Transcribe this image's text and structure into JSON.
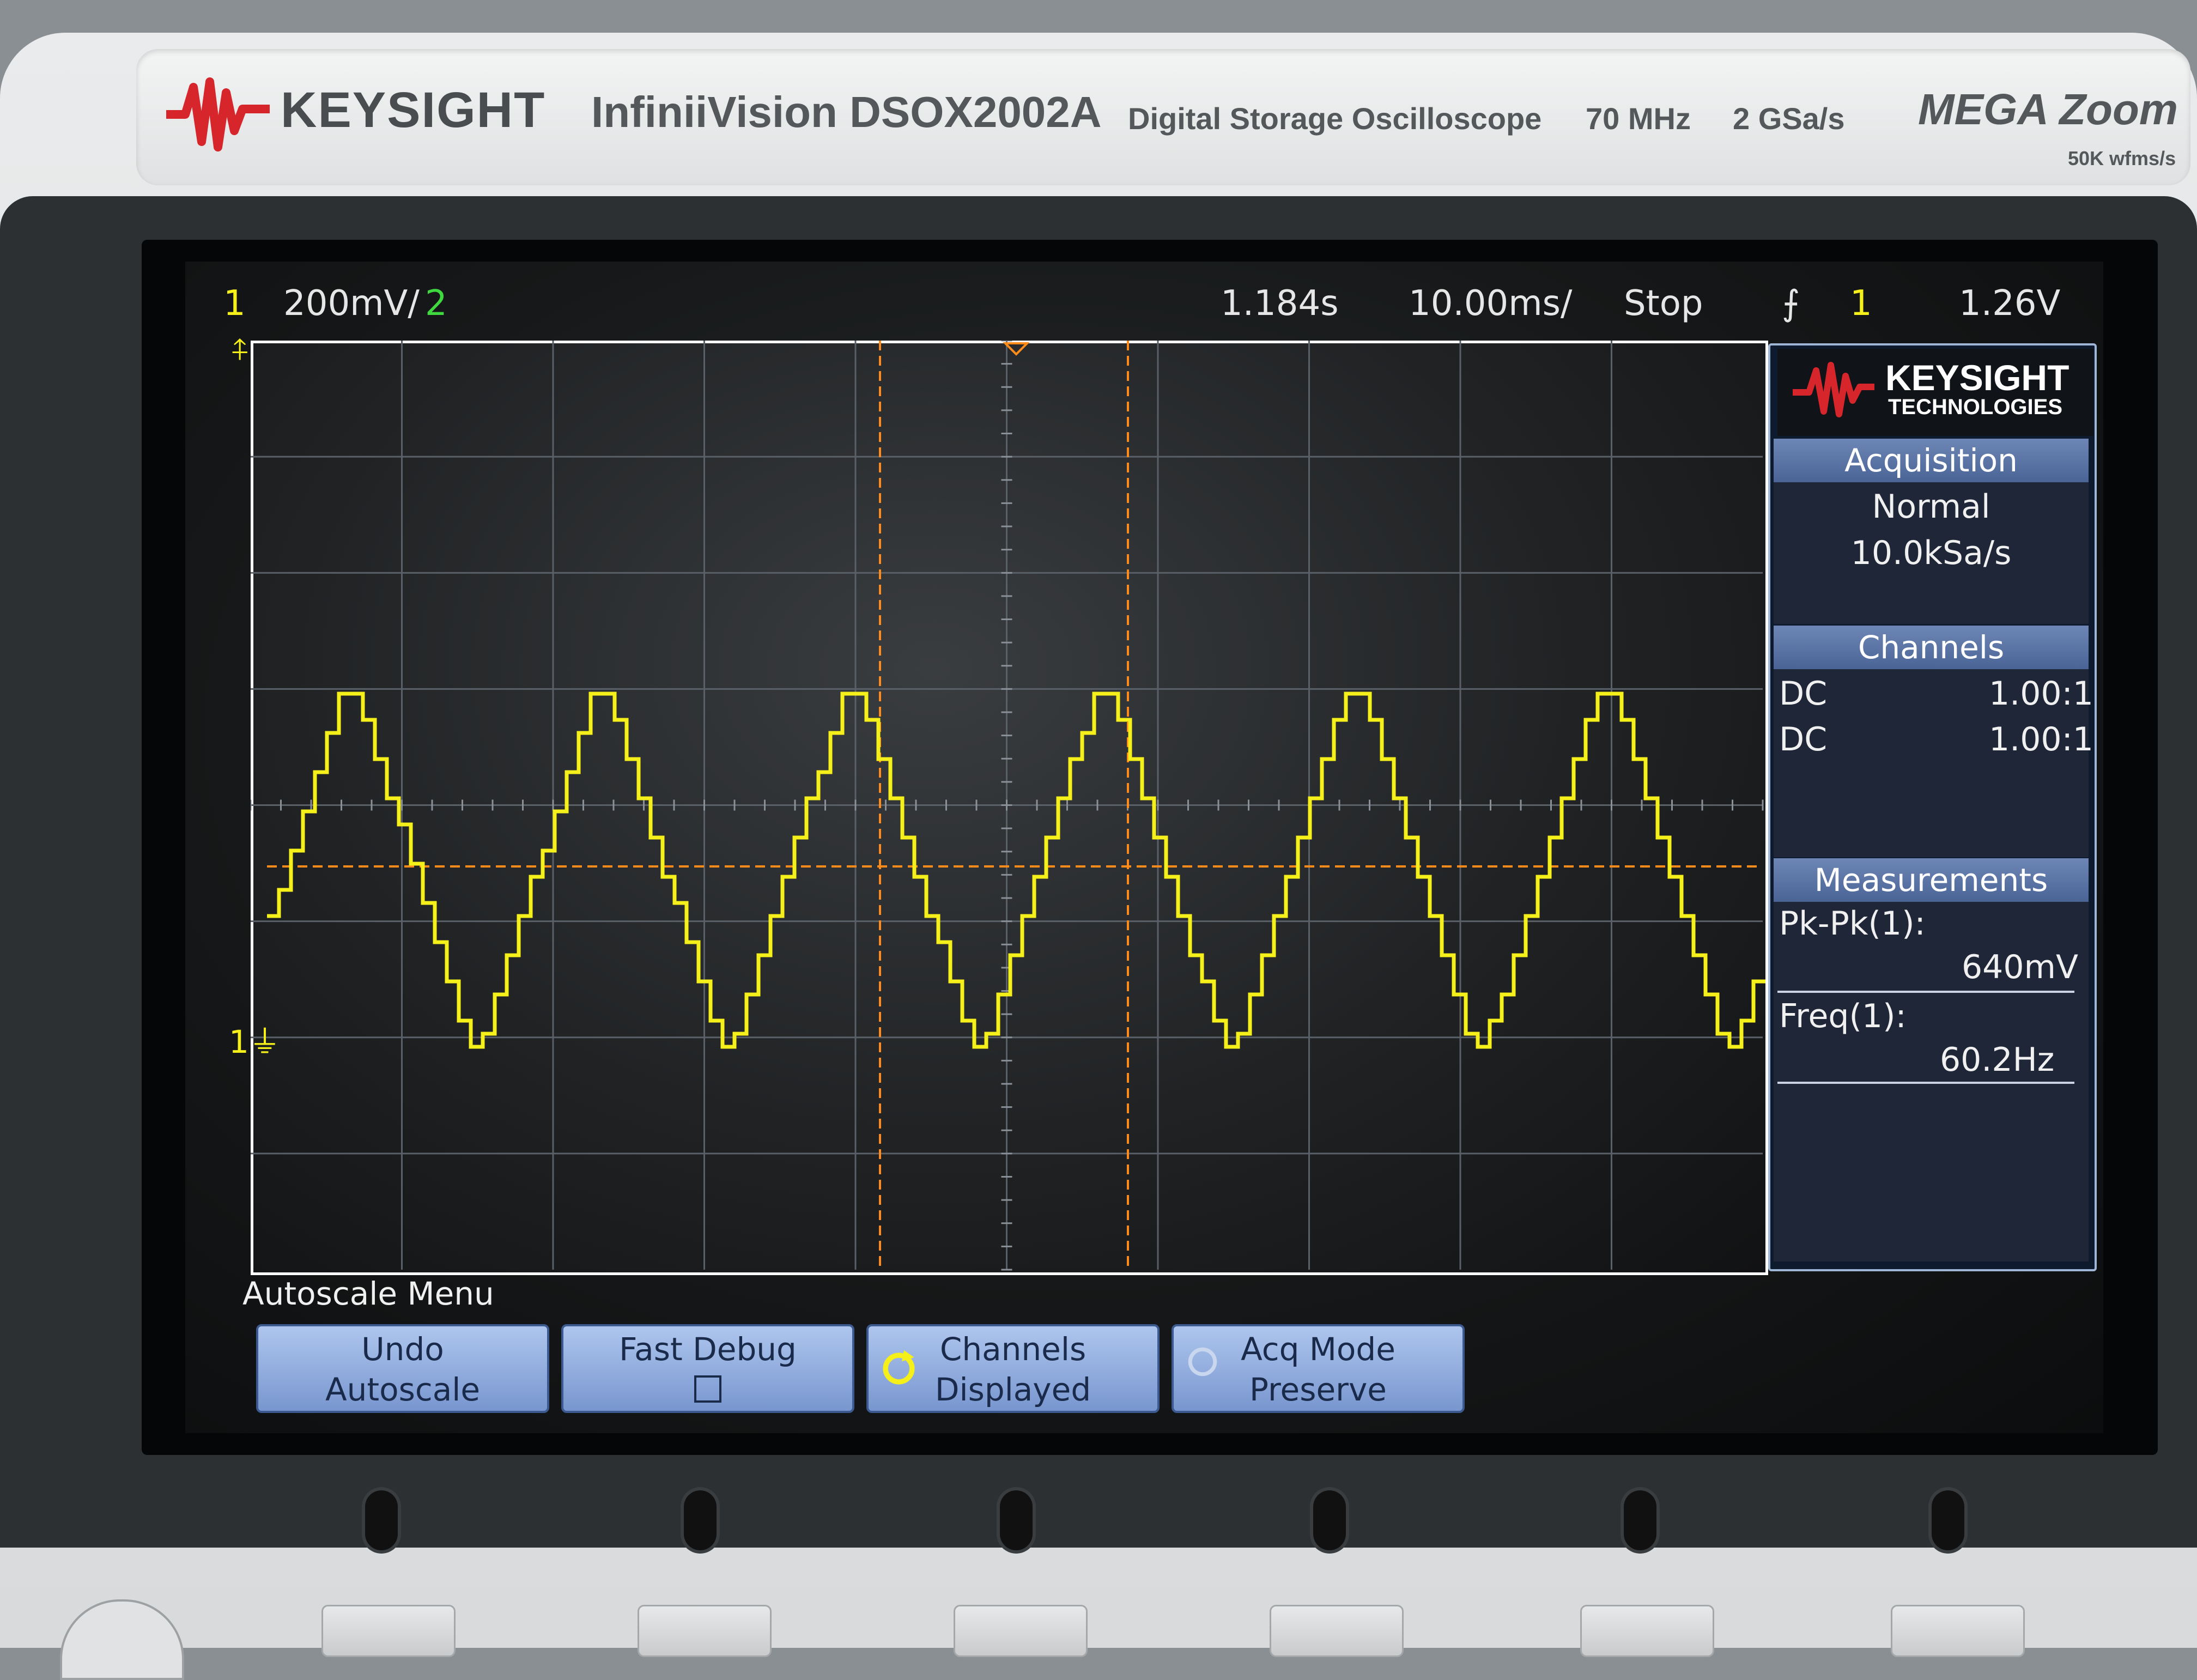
{
  "device": {
    "brand": "KEYSIGHT",
    "model": "InfiniiVision DSOX2002A",
    "description": "Digital Storage Oscilloscope",
    "bandwidth": "70 MHz",
    "sample_rate": "2 GSa/s",
    "megazoom": "MEGA Zoom",
    "wfms": "50K wfms/s"
  },
  "status": {
    "ch1_label": "1",
    "ch1_scale": "200mV/",
    "ch2_label": "2",
    "time_delay": "1.184s",
    "time_scale": "10.00ms/",
    "run_state": "Stop",
    "trigger_source": "1",
    "trigger_level": "1.26V"
  },
  "panel": {
    "logo_name": "KEYSIGHT",
    "logo_sub": "TECHNOLOGIES",
    "acquisition": {
      "title": "Acquisition",
      "mode": "Normal",
      "rate": "10.0kSa/s"
    },
    "channels": {
      "title": "Channels",
      "rows": [
        {
          "coupling": "DC",
          "probe": "1.00:1"
        },
        {
          "coupling": "DC",
          "probe": "1.00:1"
        }
      ]
    },
    "measurements": {
      "title": "Measurements",
      "items": [
        {
          "label": "Pk-Pk(1):",
          "value": "640mV"
        },
        {
          "label": "Freq(1):",
          "value": "60.2Hz"
        }
      ]
    }
  },
  "softkeys": {
    "menu_title": "Autoscale Menu",
    "undo_line1": "Undo",
    "undo_line2": "Autoscale",
    "fast_debug": "Fast Debug",
    "channels_line1": "Channels",
    "channels_line2": "Displayed",
    "acq_line1": "Acq Mode",
    "acq_line2": "Preserve"
  },
  "colors": {
    "ch1": "#f5ef1a",
    "ch2": "#3fd93f",
    "cursor": "#ff8c1a",
    "panel_header": "#5a74a6"
  },
  "waveform": {
    "frequency_hz": 60.2,
    "peak_to_peak_mv": 640,
    "time_per_div_ms": 10
  }
}
